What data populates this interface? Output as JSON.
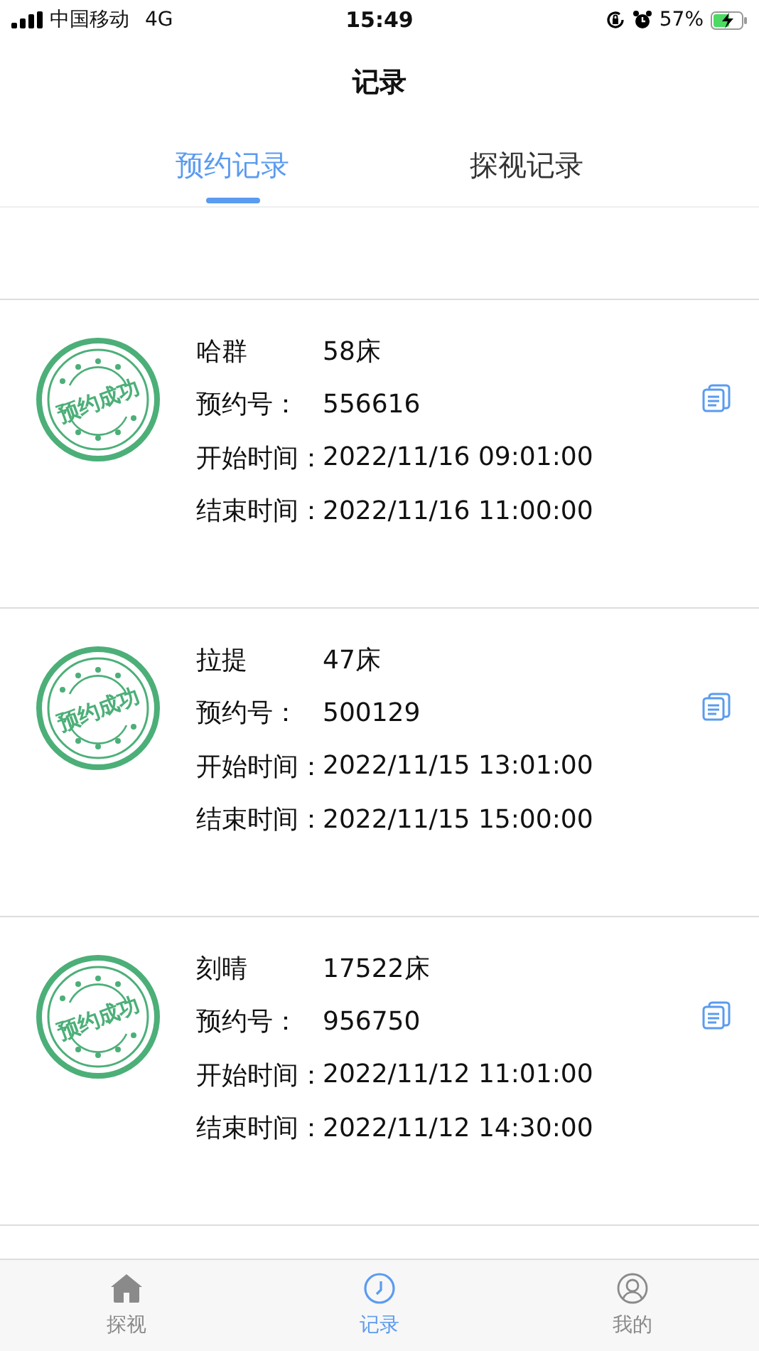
{
  "status_bar": {
    "carrier": "中国移动",
    "network": "4G",
    "time": "15:49",
    "battery": "57%"
  },
  "title": "记录",
  "tabs": [
    {
      "label": "预约记录",
      "selected": true
    },
    {
      "label": "探视记录",
      "selected": false
    }
  ],
  "records": [
    {
      "stamp": "预约成功",
      "name": "哈群",
      "bed": "58床",
      "fields": [
        {
          "label": "预约号：",
          "value": "556616"
        },
        {
          "label": "开始时间：",
          "value": "2022/11/16 09:01:00"
        },
        {
          "label": "结束时间：",
          "value": "2022/11/16 11:00:00"
        }
      ]
    },
    {
      "stamp": "预约成功",
      "name": "拉提",
      "bed": "47床",
      "fields": [
        {
          "label": "预约号：",
          "value": "500129"
        },
        {
          "label": "开始时间：",
          "value": "2022/11/15 13:01:00"
        },
        {
          "label": "结束时间：",
          "value": "2022/11/15 15:00:00"
        }
      ]
    },
    {
      "stamp": "预约成功",
      "name": "刻晴",
      "bed": "17522床",
      "fields": [
        {
          "label": "预约号：",
          "value": "956750"
        },
        {
          "label": "开始时间：",
          "value": "2022/11/12 11:01:00"
        },
        {
          "label": "结束时间：",
          "value": "2022/11/12 14:30:00"
        }
      ]
    }
  ],
  "nav": [
    {
      "kind": "home",
      "label": "探视",
      "selected": false
    },
    {
      "kind": "clock",
      "label": "记录",
      "selected": true
    },
    {
      "kind": "user",
      "label": "我的",
      "selected": false
    }
  ]
}
